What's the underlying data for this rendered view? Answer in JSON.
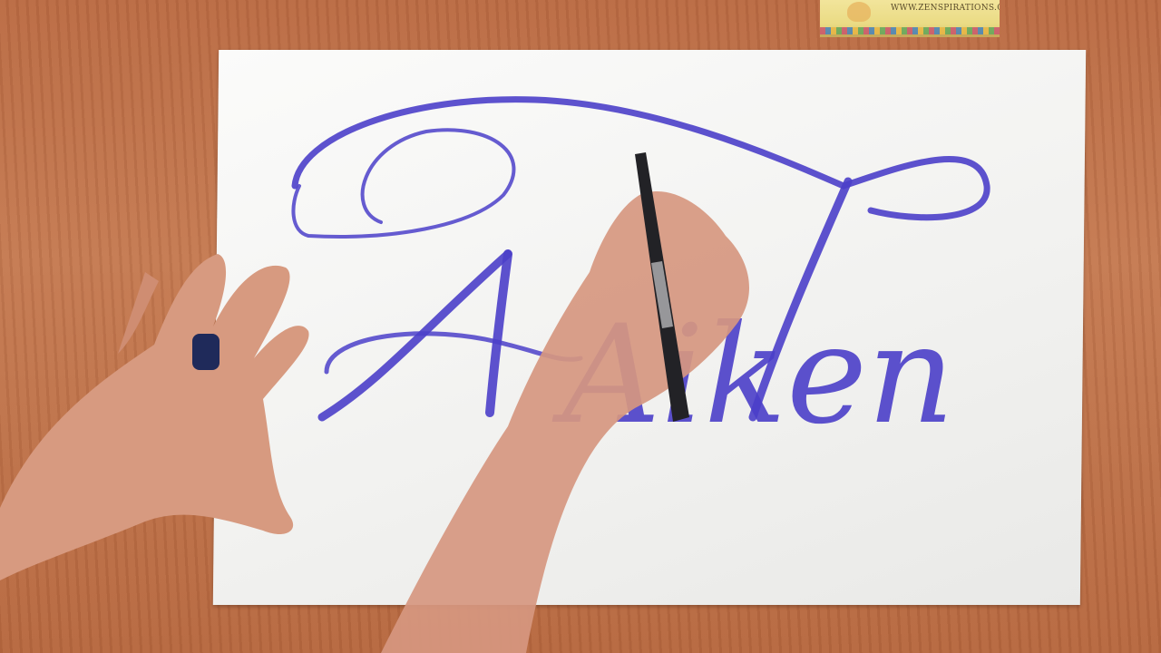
{
  "scene": {
    "description_note": "",
    "sticker": {
      "url": "WWW.ZENSPIRATIONS.COM"
    },
    "lettering": {
      "word": "Aiken"
    },
    "colors": {
      "desk": "#c47a52",
      "paper": "#f4f4f2",
      "ink": "#4b3fc9",
      "skin": "#d99a7e",
      "marker": "#222226"
    }
  }
}
